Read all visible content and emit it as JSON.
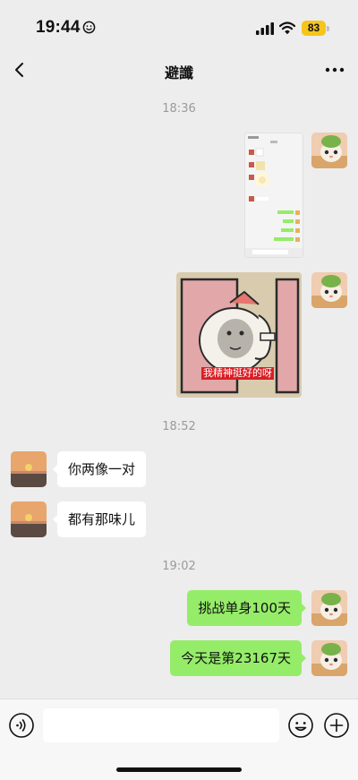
{
  "status_bar": {
    "time": "19:44",
    "time_icon": "smiley-face-icon",
    "battery_level": "83",
    "battery_color": "#f5c51b"
  },
  "nav": {
    "title": "避讖",
    "back_icon": "chevron-left-icon",
    "more_icon": "ellipsis-icon"
  },
  "messages": {
    "time_1": "18:36",
    "time_2": "18:52",
    "time_3": "19:02",
    "left_1": "你两像一对",
    "left_2": "都有那味儿",
    "right_1": "挑战单身100天",
    "right_2": "今天是第23167天"
  },
  "sticker": {
    "caption": "我精神挺好的呀"
  },
  "input_bar": {
    "placeholder": "",
    "voice_icon": "voice-wave-icon",
    "emoji_icon": "smiley-icon",
    "plus_icon": "plus-circle-icon"
  },
  "colors": {
    "background": "#ededed",
    "sent_bubble": "#95ec69",
    "received_bubble": "#ffffff",
    "timestamp": "#9a9a9a"
  }
}
